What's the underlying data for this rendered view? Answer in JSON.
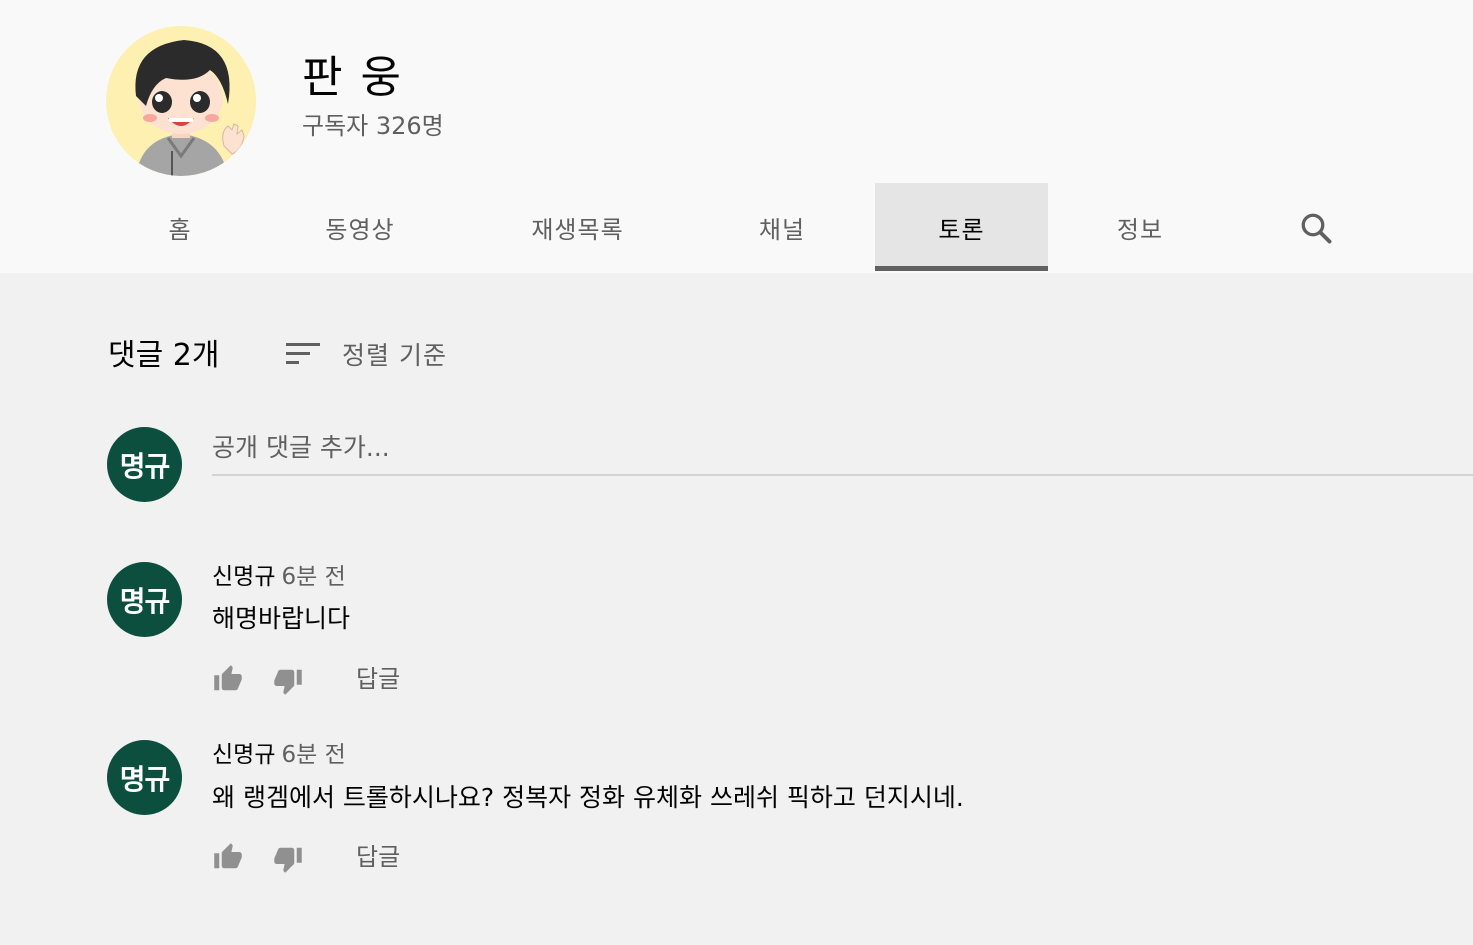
{
  "channel": {
    "name": "판 웅",
    "subscribers": "구독자 326명"
  },
  "tabs": [
    {
      "label": "홈"
    },
    {
      "label": "동영상"
    },
    {
      "label": "재생목록"
    },
    {
      "label": "채널"
    },
    {
      "label": "토론",
      "active": true
    },
    {
      "label": "정보"
    }
  ],
  "search_icon": "search-icon",
  "comments_section": {
    "count_label": "댓글 2개",
    "sort_label": "정렬 기준",
    "input_placeholder": "공개 댓글 추가...",
    "current_user_avatar": "명규"
  },
  "comments": [
    {
      "avatar_text": "명규",
      "author": "신명규",
      "time": "6분 전",
      "text": "해명바랍니다",
      "reply_label": "답글"
    },
    {
      "avatar_text": "명규",
      "author": "신명규",
      "time": "6분 전",
      "text": "왜 랭겜에서 트롤하시나요? 정복자 정화 유체화 쓰레쉬 픽하고 던지시네.",
      "reply_label": "답글"
    }
  ],
  "colors": {
    "header_bg": "#f9f9f9",
    "page_bg": "#f1f1f1",
    "avatar_green": "#0c4f3f",
    "secondary_text": "#606060"
  }
}
